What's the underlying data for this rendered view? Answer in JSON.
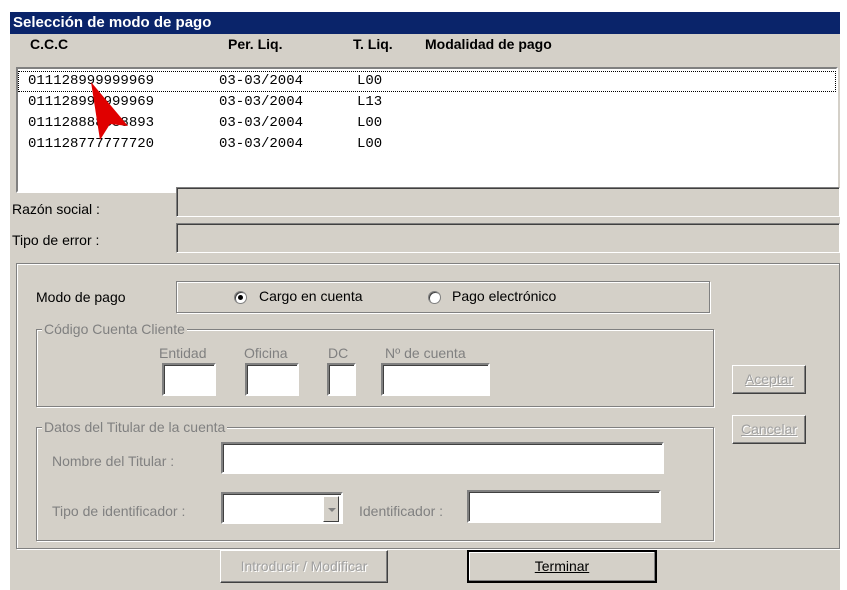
{
  "window": {
    "title": "Selección de modo de pago"
  },
  "list": {
    "headers": [
      "C.C.C",
      "Per. Liq.",
      "T. Liq.",
      "Modalidad de pago"
    ],
    "rows": [
      [
        "011128999999969",
        "03-03/2004",
        "L00",
        ""
      ],
      [
        "011128999999969",
        "03-03/2004",
        "L13",
        ""
      ],
      [
        "011128888888893",
        "03-03/2004",
        "L00",
        ""
      ],
      [
        "011128777777720",
        "03-03/2004",
        "L00",
        ""
      ]
    ],
    "selected_index": 0
  },
  "labels": {
    "razon_social": "Razón social :",
    "tipo_error": "Tipo de error :",
    "modo_pago": "Modo de pago"
  },
  "payment_mode": {
    "options": [
      "Cargo en cuenta",
      "Pago electrónico"
    ],
    "selected": "Cargo en cuenta"
  },
  "ccc_group": {
    "legend": "Código Cuenta Cliente",
    "entidad": "Entidad",
    "oficina": "Oficina",
    "dc": "DC",
    "num_cuenta": "Nº de cuenta"
  },
  "holder_group": {
    "legend": "Datos del Titular de la cuenta",
    "nombre": "Nombre del Titular :",
    "tipo_id": "Tipo de identificador :",
    "identificador": "Identificador :"
  },
  "buttons": {
    "aceptar": "Aceptar",
    "cancelar": "Cancelar",
    "introducir": "Introducir / Modificar",
    "terminar": "Terminar"
  },
  "colors": {
    "titlebar": "#0a246a",
    "face": "#d4d0c8",
    "cursor": "#e00000"
  }
}
